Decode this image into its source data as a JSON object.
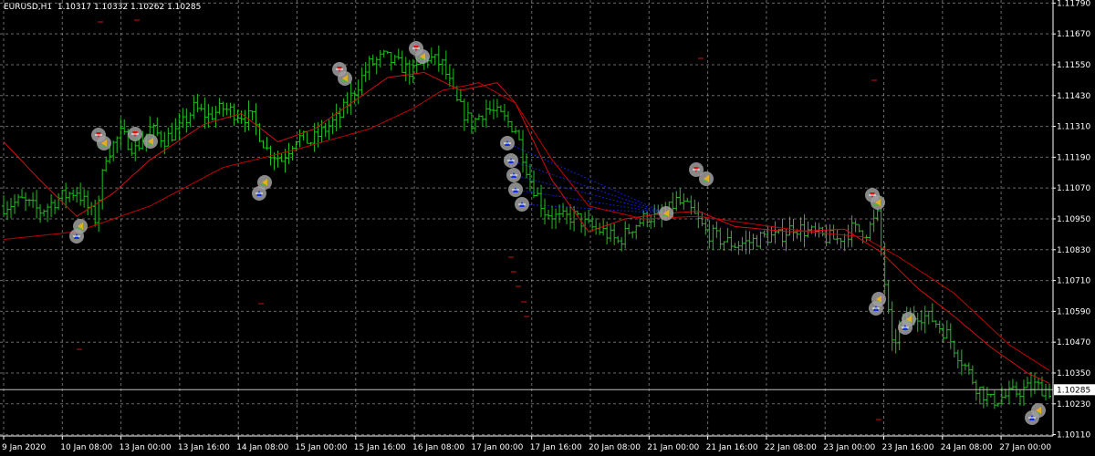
{
  "header": {
    "symbol": "EURUSD,H1",
    "ohlc": "1.10317 1.10332 1.10262 1.10285"
  },
  "colors": {
    "background": "#000000",
    "grid": "#b0b0b0",
    "candle": "#22c022",
    "ma_fast": "#d01010",
    "ma_slow": "#c00000",
    "bid_line": "#c0c0c0",
    "fib_lines": "#1020c0",
    "marker_ring": "#a0a0a0"
  },
  "icons": {
    "marker": "trade-arrow-marker-icon"
  },
  "chart_data": {
    "type": "line",
    "title": "",
    "ylim": [
      1.1011,
      1.1179
    ],
    "y_ticks": [
      "1.11790",
      "1.11670",
      "1.11550",
      "1.11430",
      "1.11310",
      "1.11190",
      "1.11070",
      "1.10950",
      "1.10830",
      "1.10710",
      "1.10590",
      "1.10470",
      "1.10350",
      "1.10230",
      "1.10110"
    ],
    "current_price": 1.10285,
    "current_price_label": "1.10285",
    "x_ticks": [
      "9 Jan 2020",
      "10 Jan 08:00",
      "13 Jan 00:00",
      "13 Jan 16:00",
      "14 Jan 08:00",
      "15 Jan 00:00",
      "15 Jan 16:00",
      "16 Jan 08:00",
      "17 Jan 00:00",
      "17 Jan 16:00",
      "20 Jan 08:00",
      "21 Jan 00:00",
      "21 Jan 16:00",
      "22 Jan 08:00",
      "23 Jan 00:00",
      "23 Jan 16:00",
      "24 Jan 08:00",
      "27 Jan 00:00"
    ],
    "close_anchors": [
      [
        0,
        1.11
      ],
      [
        5,
        1.1102
      ],
      [
        10,
        1.1098
      ],
      [
        15,
        1.1103
      ],
      [
        20,
        1.1106
      ],
      [
        25,
        1.1095
      ],
      [
        28,
        1.112
      ],
      [
        32,
        1.1128
      ],
      [
        36,
        1.1122
      ],
      [
        40,
        1.113
      ],
      [
        44,
        1.1126
      ],
      [
        48,
        1.113
      ],
      [
        52,
        1.1138
      ],
      [
        56,
        1.1135
      ],
      [
        60,
        1.1138
      ],
      [
        64,
        1.1136
      ],
      [
        68,
        1.1134
      ],
      [
        72,
        1.1122
      ],
      [
        76,
        1.1118
      ],
      [
        80,
        1.1127
      ],
      [
        84,
        1.1125
      ],
      [
        88,
        1.113
      ],
      [
        92,
        1.1135
      ],
      [
        96,
        1.1145
      ],
      [
        100,
        1.1155
      ],
      [
        104,
        1.1158
      ],
      [
        108,
        1.1155
      ],
      [
        112,
        1.1152
      ],
      [
        116,
        1.1158
      ],
      [
        120,
        1.1155
      ],
      [
        124,
        1.114
      ],
      [
        128,
        1.1132
      ],
      [
        132,
        1.1138
      ],
      [
        136,
        1.1135
      ],
      [
        140,
        1.113
      ],
      [
        144,
        1.111
      ],
      [
        148,
        1.1098
      ],
      [
        152,
        1.1095
      ],
      [
        156,
        1.1096
      ],
      [
        160,
        1.1092
      ],
      [
        164,
        1.109
      ],
      [
        168,
        1.1086
      ],
      [
        172,
        1.1092
      ],
      [
        176,
        1.1096
      ],
      [
        180,
        1.1095
      ],
      [
        184,
        1.1102
      ],
      [
        188,
        1.1098
      ],
      [
        192,
        1.109
      ],
      [
        196,
        1.1087
      ],
      [
        200,
        1.1085
      ],
      [
        204,
        1.1086
      ],
      [
        208,
        1.1088
      ],
      [
        212,
        1.1088
      ],
      [
        216,
        1.1092
      ],
      [
        220,
        1.109
      ],
      [
        224,
        1.1088
      ],
      [
        228,
        1.1087
      ],
      [
        232,
        1.1091
      ],
      [
        236,
        1.109
      ],
      [
        239,
        1.1096
      ],
      [
        241,
        1.107
      ],
      [
        243,
        1.1045
      ],
      [
        246,
        1.1055
      ],
      [
        250,
        1.1058
      ],
      [
        254,
        1.1056
      ],
      [
        258,
        1.105
      ],
      [
        262,
        1.104
      ],
      [
        266,
        1.103
      ],
      [
        270,
        1.1024
      ],
      [
        274,
        1.1026
      ],
      [
        278,
        1.1028
      ],
      [
        282,
        1.103
      ],
      [
        286,
        1.1028
      ]
    ],
    "ma_fast_anchors": [
      [
        0,
        1.1125
      ],
      [
        10,
        1.111
      ],
      [
        20,
        1.1096
      ],
      [
        30,
        1.1105
      ],
      [
        40,
        1.1118
      ],
      [
        55,
        1.1132
      ],
      [
        65,
        1.1136
      ],
      [
        75,
        1.1125
      ],
      [
        85,
        1.113
      ],
      [
        95,
        1.114
      ],
      [
        105,
        1.115
      ],
      [
        115,
        1.1152
      ],
      [
        125,
        1.1145
      ],
      [
        135,
        1.1148
      ],
      [
        140,
        1.114
      ],
      [
        150,
        1.111
      ],
      [
        160,
        1.109
      ],
      [
        170,
        1.1095
      ],
      [
        180,
        1.1097
      ],
      [
        190,
        1.1098
      ],
      [
        200,
        1.1092
      ],
      [
        215,
        1.109
      ],
      [
        230,
        1.1091
      ],
      [
        240,
        1.1082
      ],
      [
        250,
        1.1068
      ],
      [
        260,
        1.1057
      ],
      [
        270,
        1.1045
      ],
      [
        280,
        1.1035
      ],
      [
        286,
        1.1031
      ]
    ],
    "ma_slow_anchors": [
      [
        0,
        1.1087
      ],
      [
        20,
        1.109
      ],
      [
        40,
        1.11
      ],
      [
        60,
        1.1115
      ],
      [
        80,
        1.1122
      ],
      [
        100,
        1.113
      ],
      [
        112,
        1.1138
      ],
      [
        120,
        1.1145
      ],
      [
        130,
        1.1148
      ],
      [
        140,
        1.114
      ],
      [
        150,
        1.1118
      ],
      [
        160,
        1.11
      ],
      [
        175,
        1.1095
      ],
      [
        190,
        1.1096
      ],
      [
        205,
        1.1093
      ],
      [
        220,
        1.109
      ],
      [
        235,
        1.1088
      ],
      [
        245,
        1.108
      ],
      [
        260,
        1.1066
      ],
      [
        275,
        1.1046
      ],
      [
        286,
        1.1036
      ]
    ],
    "trade_markers": [
      [
        108,
        148,
        "sell"
      ],
      [
        114,
        157,
        "close"
      ],
      [
        148,
        147,
        "sell"
      ],
      [
        165,
        155,
        "close"
      ],
      [
        88,
        248,
        "close"
      ],
      [
        84,
        259,
        "buy"
      ],
      [
        372,
        76,
        "sell"
      ],
      [
        378,
        86,
        "close"
      ],
      [
        456,
        53,
        "sell"
      ],
      [
        463,
        62,
        "close"
      ],
      [
        290,
        200,
        "close"
      ],
      [
        284,
        212,
        "buy"
      ],
      [
        556,
        157,
        "buy"
      ],
      [
        560,
        176,
        "buy"
      ],
      [
        563,
        192,
        "buy"
      ],
      [
        565,
        208,
        "buy"
      ],
      [
        572,
        224,
        "buy"
      ],
      [
        730,
        234,
        "close"
      ],
      [
        763,
        186,
        "sell"
      ],
      [
        774,
        196,
        "close"
      ],
      [
        956,
        214,
        "sell"
      ],
      [
        962,
        222,
        "close"
      ],
      [
        963,
        328,
        "close"
      ],
      [
        960,
        338,
        "buy"
      ],
      [
        996,
        350,
        "close"
      ],
      [
        992,
        359,
        "buy"
      ],
      [
        1138,
        450,
        "close"
      ],
      [
        1131,
        458,
        "buy"
      ]
    ],
    "fib_origin": [
      730,
      234
    ],
    "fib_targets": [
      [
        556,
        157
      ],
      [
        560,
        176
      ],
      [
        563,
        192
      ],
      [
        565,
        208
      ],
      [
        572,
        224
      ]
    ],
    "stop_dashes": [
      [
        110,
        24
      ],
      [
        150,
        22
      ],
      [
        768,
        64
      ],
      [
        958,
        88
      ],
      [
        286,
        333
      ],
      [
        87,
        383
      ],
      [
        560,
        282
      ],
      [
        563,
        298
      ],
      [
        568,
        314
      ],
      [
        574,
        331
      ],
      [
        577,
        347
      ],
      [
        963,
        460
      ]
    ]
  }
}
